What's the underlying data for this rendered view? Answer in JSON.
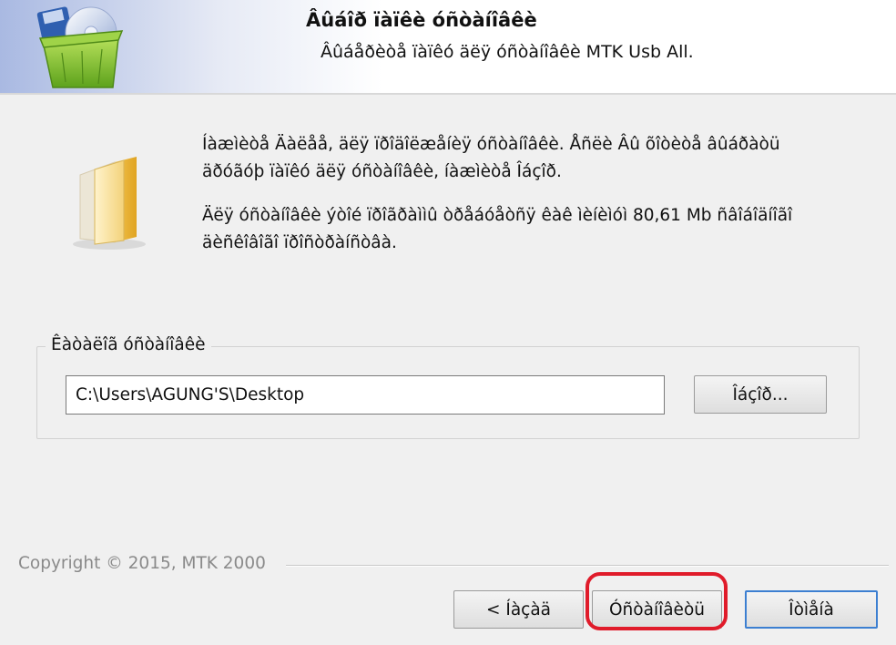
{
  "header": {
    "title": "Âûáîð ïàïêè óñòàíîâêè",
    "subtitle": "Âûáåðèòå ïàïêó äëÿ óñòàíîâêè MTK Usb All."
  },
  "body": {
    "paragraph1_line1": "Íàæìèòå Äàëåå, äëÿ ïðîäîëæåíèÿ óñòàíîâêè. Åñëè Âû õîòèòå âûáðàòü",
    "paragraph1_line2": "äðóãóþ ïàïêó äëÿ óñòàíîâêè, íàæìèòå Îáçîð.",
    "paragraph2_line1": "Äëÿ óñòàíîâêè ýòîé ïðîãðàììû òðåáóåòñÿ êàê ìèíèìóì 80,61 Mb ñâîáîäíîãî",
    "paragraph2_line2": "äèñêîâîãî ïðîñòðàíñòâà."
  },
  "folder_group": {
    "legend": "Êàòàëîã óñòàíîâêè",
    "path_value": "C:\\Users\\AGUNG'S\\Desktop",
    "browse_label": "Îáçîð..."
  },
  "footer": {
    "copyright": "Copyright © 2015, MTK 2000",
    "back_label": "< Íàçàä",
    "install_label": "Óñòàíîâèòü",
    "cancel_label": "Îòìåíà"
  },
  "colors": {
    "highlight": "#e01b2a",
    "default_button_border": "#3c7fd1"
  },
  "icons": {
    "header": "installer-box-icon",
    "body": "folder-icon"
  }
}
